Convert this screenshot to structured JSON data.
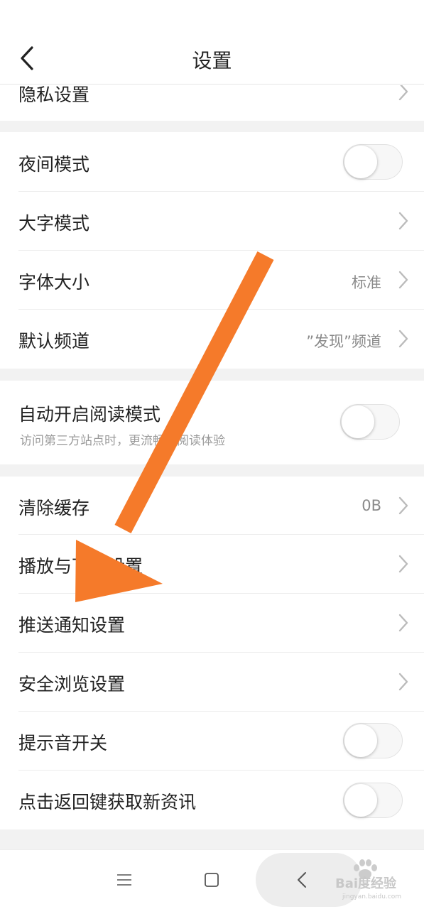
{
  "header": {
    "title": "设置"
  },
  "rows": {
    "privacy": {
      "label": "隐私设置"
    },
    "night_mode": {
      "label": "夜间模式",
      "on": false
    },
    "large_text": {
      "label": "大字模式"
    },
    "font_size": {
      "label": "字体大小",
      "value": "标准"
    },
    "default_channel": {
      "label": "默认频道",
      "value": "”发现”频道"
    },
    "auto_reader": {
      "label": "自动开启阅读模式",
      "sub": "访问第三方站点时，更流畅的阅读体验",
      "on": false
    },
    "clear_cache": {
      "label": "清除缓存",
      "value": "0B"
    },
    "playback": {
      "label": "播放与下载设置"
    },
    "push": {
      "label": "推送通知设置"
    },
    "safe_browse": {
      "label": "安全浏览设置"
    },
    "sound": {
      "label": "提示音开关",
      "on": false
    },
    "back_refresh": {
      "label": "点击返回键获取新资讯",
      "on": false
    }
  },
  "nav": {
    "icons": [
      "menu-icon",
      "home-square-icon",
      "back-chevron-icon"
    ]
  },
  "watermark": {
    "text": "Bai度经验",
    "sub": "jingyan.baidu.com"
  },
  "colors": {
    "arrow": "#F57A2A",
    "background_gap": "#F2F2F2",
    "text": "#222222",
    "secondary": "#8A8A8A"
  }
}
